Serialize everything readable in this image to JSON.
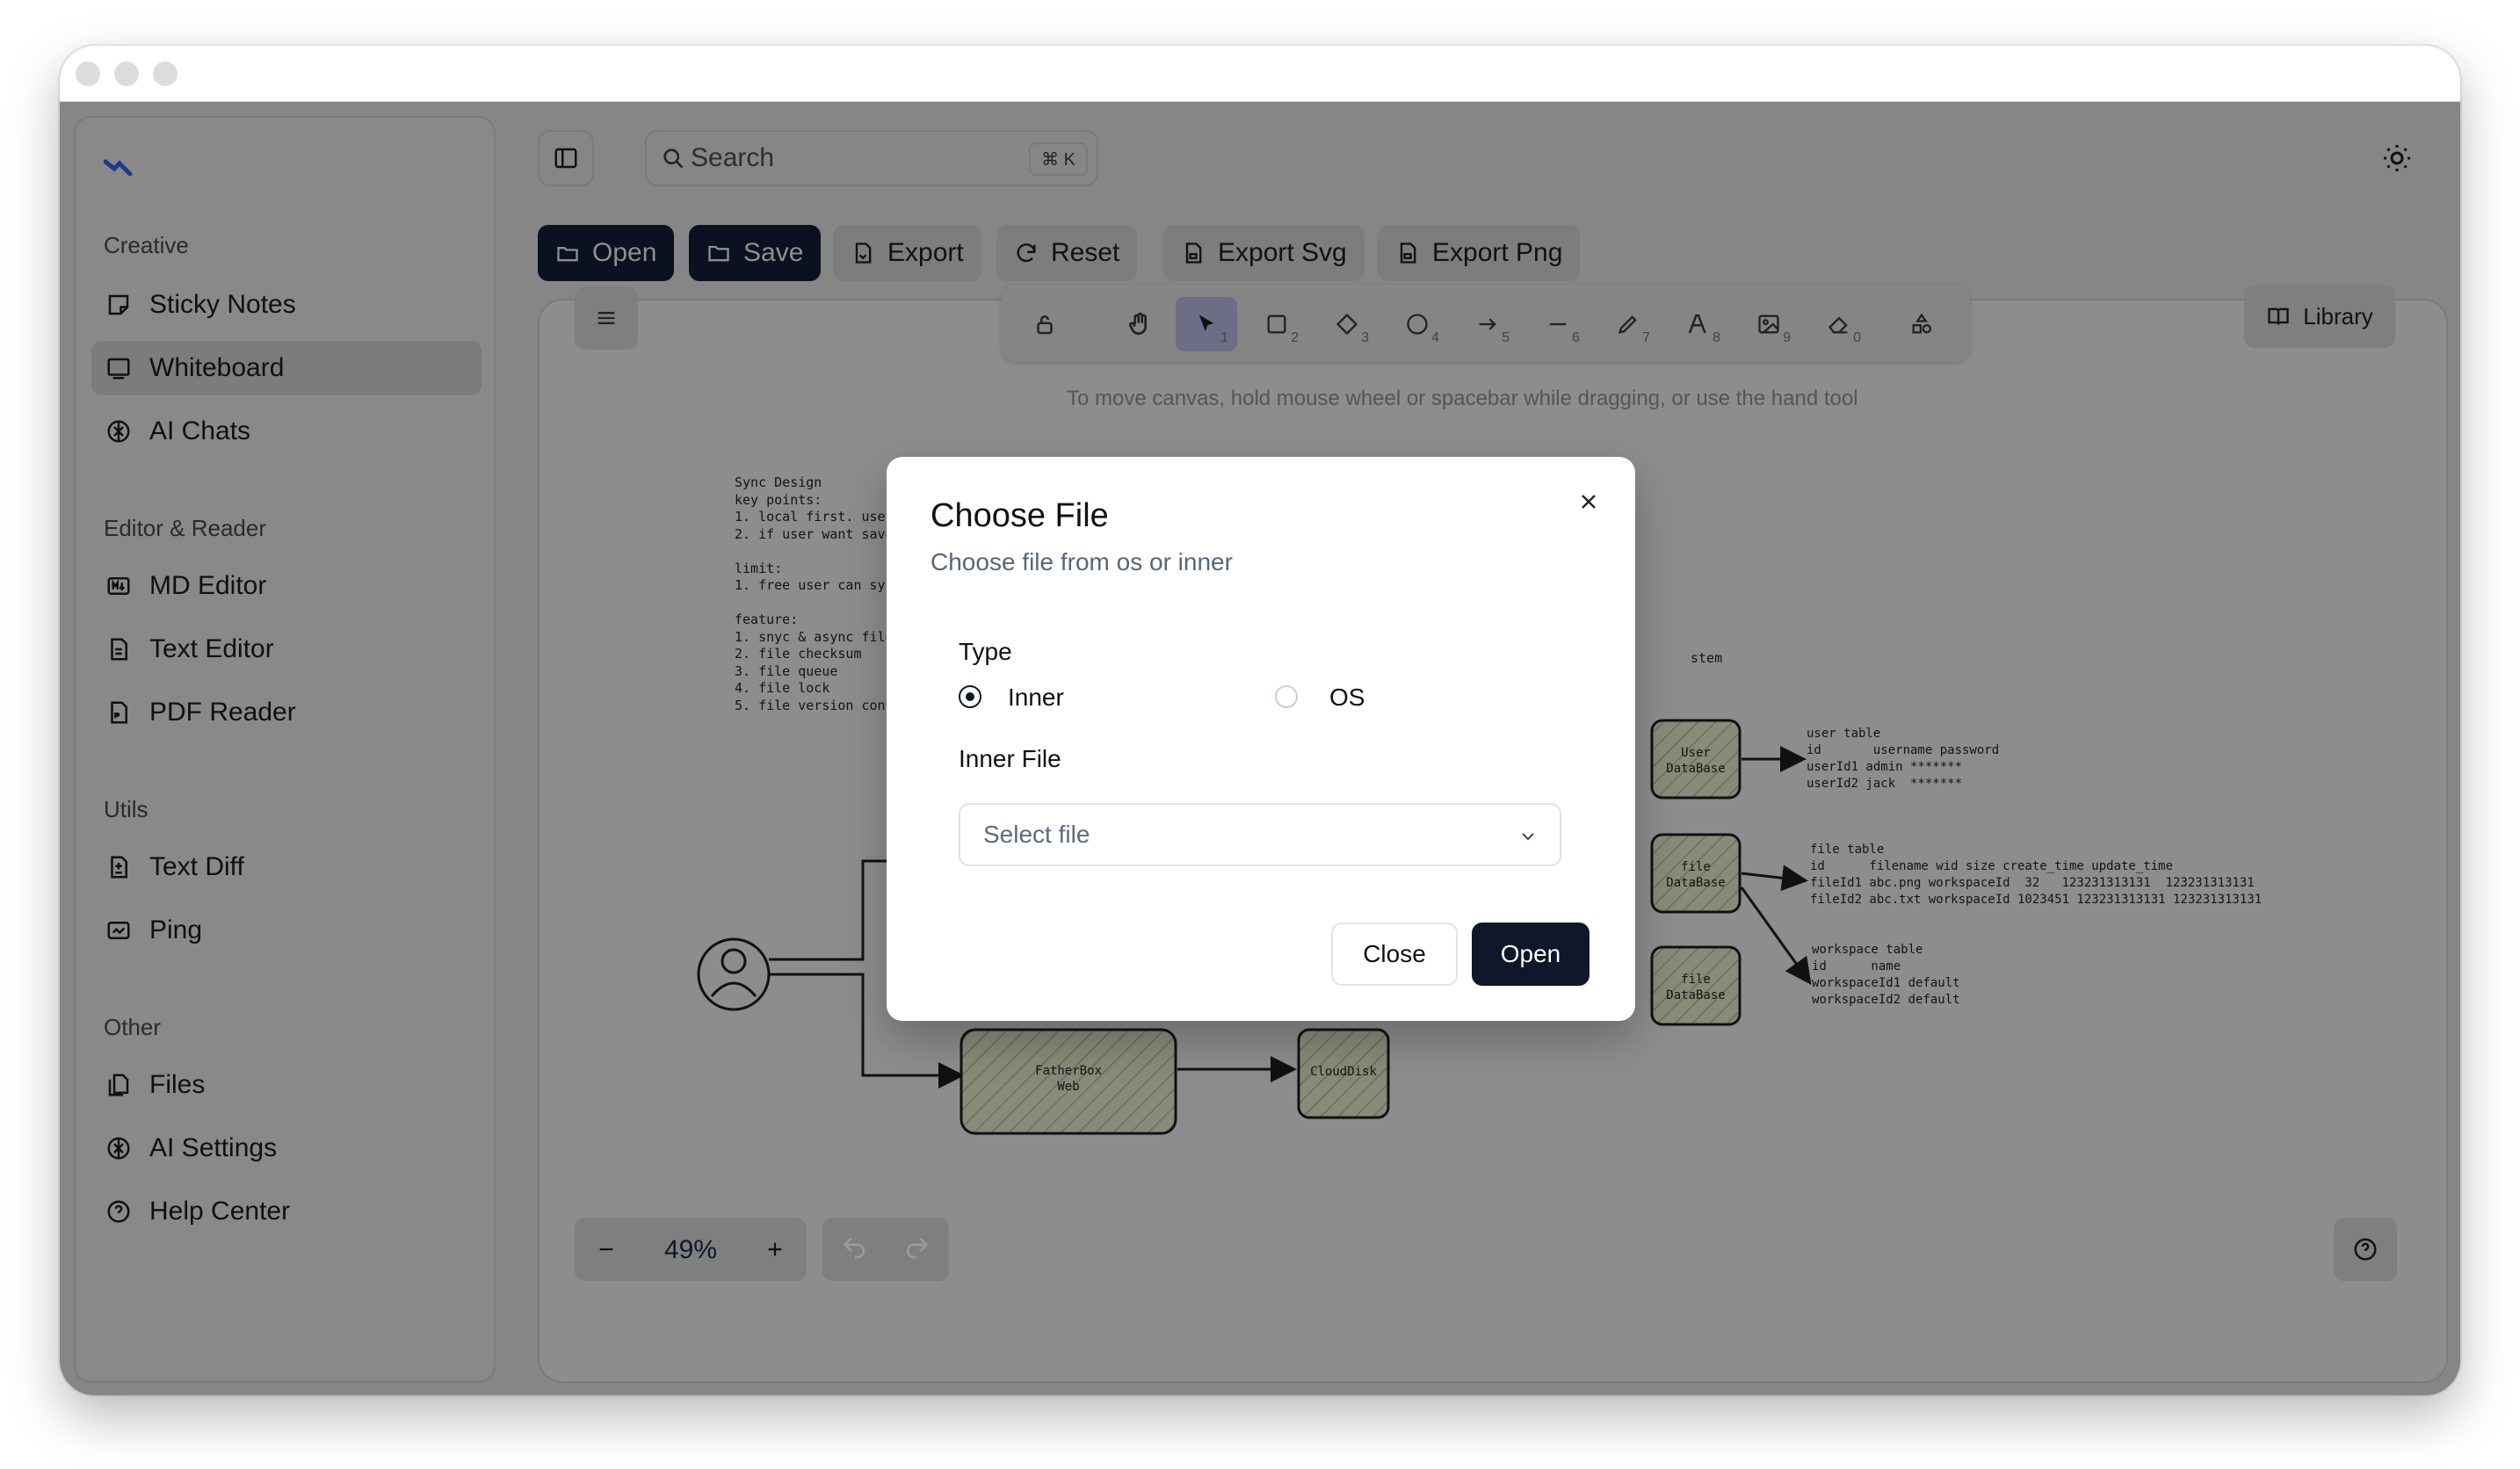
{
  "sidebar": {
    "groups": [
      {
        "label": "Creative",
        "items": [
          {
            "label": "Sticky Notes",
            "icon": "sticky-note-icon"
          },
          {
            "label": "Whiteboard",
            "icon": "whiteboard-icon",
            "active": true
          },
          {
            "label": "AI Chats",
            "icon": "ai-icon"
          }
        ]
      },
      {
        "label": "Editor & Reader",
        "items": [
          {
            "label": "MD Editor",
            "icon": "markdown-icon"
          },
          {
            "label": "Text Editor",
            "icon": "file-text-icon"
          },
          {
            "label": "PDF Reader",
            "icon": "pdf-icon"
          }
        ]
      },
      {
        "label": "Utils",
        "items": [
          {
            "label": "Text Diff",
            "icon": "diff-icon"
          },
          {
            "label": "Ping",
            "icon": "ping-icon"
          }
        ]
      },
      {
        "label": "Other",
        "items": [
          {
            "label": "Files",
            "icon": "files-icon"
          },
          {
            "label": "AI Settings",
            "icon": "ai-icon"
          },
          {
            "label": "Help Center",
            "icon": "help-icon"
          }
        ]
      }
    ]
  },
  "header": {
    "search_placeholder": "Search",
    "search_shortcut": "⌘ K"
  },
  "toolbar": {
    "open": "Open",
    "save": "Save",
    "export": "Export",
    "reset": "Reset",
    "export_svg": "Export Svg",
    "export_png": "Export Png"
  },
  "canvas": {
    "library": "Library",
    "hint": "To move canvas, hold mouse wheel or spacebar while dragging, or use the hand tool",
    "zoom": "49%",
    "tools": [
      {
        "icon": "lock-icon",
        "key": ""
      },
      {
        "icon": "hand-icon",
        "key": ""
      },
      {
        "icon": "pointer-icon",
        "key": "1",
        "active": true
      },
      {
        "icon": "rectangle-icon",
        "key": "2"
      },
      {
        "icon": "diamond-icon",
        "key": "3"
      },
      {
        "icon": "ellipse-icon",
        "key": "4"
      },
      {
        "icon": "arrow-icon",
        "key": "5"
      },
      {
        "icon": "line-icon",
        "key": "6"
      },
      {
        "icon": "pencil-icon",
        "key": "7"
      },
      {
        "icon": "text-icon",
        "key": "8"
      },
      {
        "icon": "image-icon",
        "key": "9"
      },
      {
        "icon": "eraser-icon",
        "key": "0"
      },
      {
        "icon": "shapes-icon",
        "key": ""
      }
    ],
    "notes": "Sync Design\nkey points:\n1. local first. user\n2. if user want save\n\nlimit:\n1. free user can syn\n\nfeature:\n1. snyc & async file\n2. file checksum\n3. file queue\n4. file lock\n5. file version cont",
    "stem_text": "stem",
    "nodes": {
      "user_db": "User\nDataBase",
      "file_db": "file\nDataBase",
      "file_db2": "file\nDataBase",
      "fatherbox": "FatherBox\nWeb",
      "cloudisk": "CloudDisk"
    },
    "tables": {
      "user": "user table\nid       username password\nuserId1 admin *******\nuserId2 jack  *******",
      "file": "file table\nid      filename wid size create_time update_time\nfileId1 abc.png workspaceId  32   123231313131  123231313131\nfileId2 abc.txt workspaceId 1023451 123231313131 123231313131",
      "workspace": "workspace table\nid      name\nworkspaceId1 default\nworkspaceId2 default"
    }
  },
  "dialog": {
    "title": "Choose File",
    "subtitle": "Choose file from os or inner",
    "type_label": "Type",
    "option_inner": "Inner",
    "option_os": "OS",
    "selected": "Inner",
    "inner_file_label": "Inner File",
    "select_placeholder": "Select file",
    "close": "Close",
    "open": "Open"
  }
}
